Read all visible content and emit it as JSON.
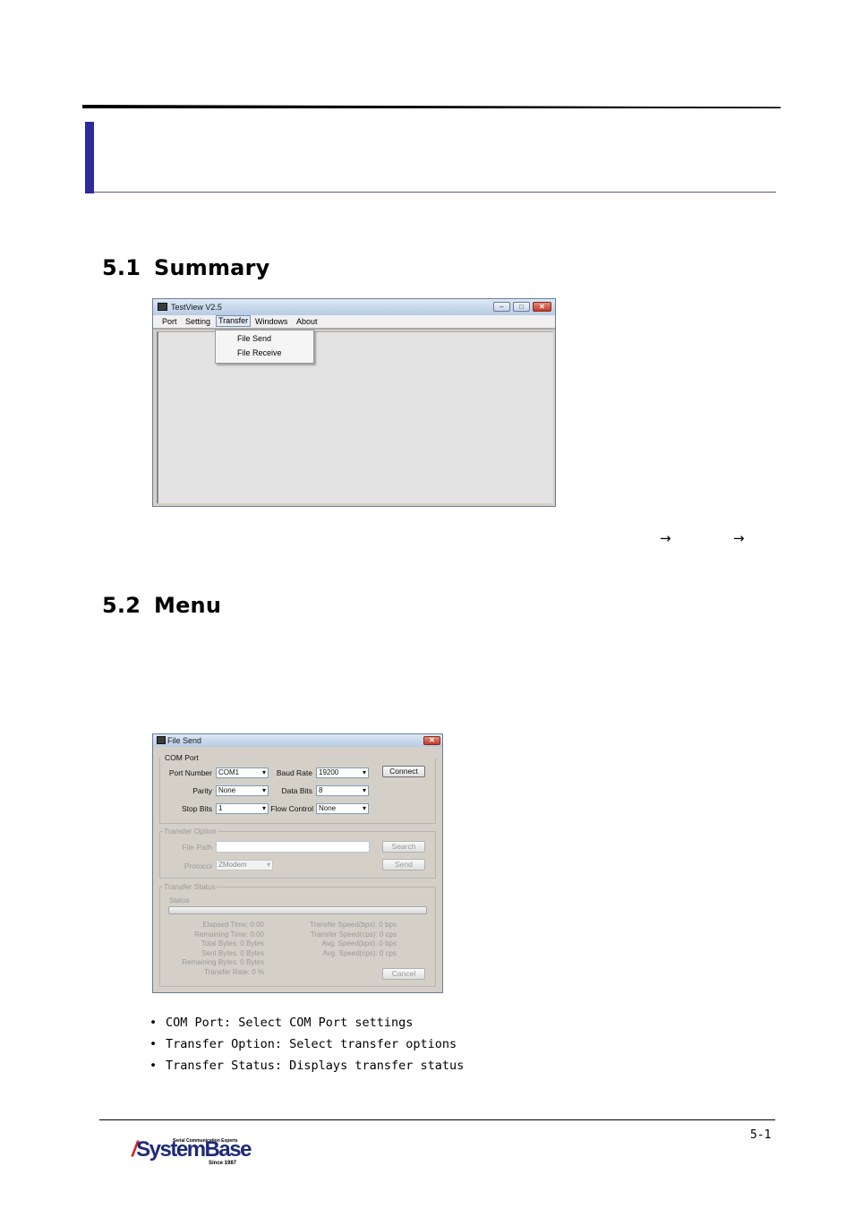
{
  "sections": {
    "summary": {
      "number": "5.1",
      "title": "Summary"
    },
    "menu": {
      "number": "5.2",
      "title": "Menu"
    }
  },
  "arrows": [
    "→",
    "→"
  ],
  "main_window": {
    "title": "TestView V2.5",
    "menu": [
      "Port",
      "Setting",
      "Transfer",
      "Windows",
      "About"
    ],
    "dropdown": [
      "File Send",
      "File Receive"
    ]
  },
  "file_send": {
    "title": "File Send",
    "com_port": {
      "title": "COM Port",
      "port_number_label": "Port Number",
      "port_number": "COM1",
      "baud_rate_label": "Baud Rate",
      "baud_rate": "19200",
      "connect": "Connect",
      "parity_label": "Parity",
      "parity": "None",
      "data_bits_label": "Data Bits",
      "data_bits": "8",
      "stop_bits_label": "Stop Bits",
      "stop_bits": "1",
      "flow_control_label": "Flow Control",
      "flow_control": "None"
    },
    "transfer_option": {
      "title": "Transfer Option",
      "file_path_label": "File Path",
      "search": "Search",
      "protocol_label": "Protocol",
      "protocol": "ZModem",
      "send": "Send"
    },
    "transfer_status": {
      "title": "Transfer Status",
      "status_label": "Status",
      "left": [
        "Elapsed Time: 0:00",
        "Remaining Time: 0:00",
        "Total Bytes: 0 Bytes",
        "Sent Bytes: 0 Bytes",
        "Remaining Bytes: 0 Bytes",
        "Transfer Rate: 0 %"
      ],
      "right": [
        "Transfer Speed(bps): 0 bps",
        "Transfer Speed(cps): 0 cps",
        "Avg. Speed(bps): 0 bps",
        "Avg. Speed(cps): 0 cps"
      ],
      "cancel": "Cancel"
    }
  },
  "bullets": [
    "COM Port: Select COM Port settings",
    "Transfer Option: Select transfer options",
    "Transfer Status: Displays transfer status"
  ],
  "footer": {
    "page_number": "5-1",
    "logo_tagline": "Serial Communication Experts",
    "logo_text": "SystemBase",
    "logo_since": "Since 1987"
  }
}
